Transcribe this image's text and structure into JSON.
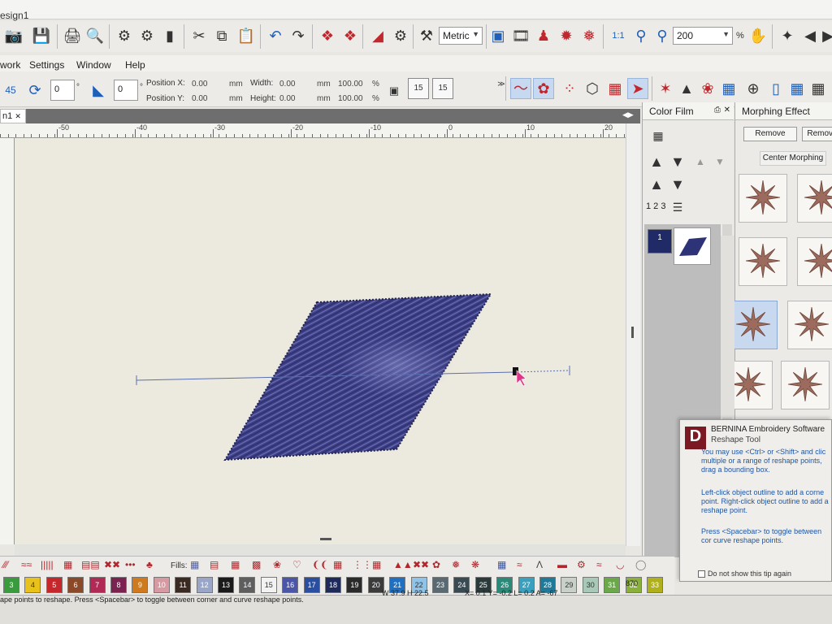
{
  "window": {
    "title": "esign1"
  },
  "toolbar1": {
    "units_value": "Metric",
    "zoom_value": "200",
    "zoom_unit": "%",
    "zoom_1to1_label": "1:1"
  },
  "menu": {
    "items": [
      "work",
      "Settings",
      "Window",
      "Help"
    ]
  },
  "toolbar2": {
    "rotate_label": "45",
    "rotate_value": "0",
    "slant_value": "0",
    "degree_symbol": "°",
    "position_x_label": "Position X:",
    "position_x_value": "0.00",
    "position_y_label": "Position Y:",
    "position_y_value": "0.00",
    "width_label": "Width:",
    "width_value": "0.00",
    "height_label": "Height:",
    "height_value": "0.00",
    "unit_mm": "mm",
    "scale_w": "100.00",
    "scale_h": "100.00",
    "percent": "%",
    "step_label": "15"
  },
  "document": {
    "tab_label": "n1",
    "close_glyph": "✕"
  },
  "ruler": {
    "labels": [
      "-50",
      "-40",
      "-30",
      "-20",
      "-10",
      "0",
      "10",
      "20"
    ]
  },
  "color_film": {
    "title": "Color Film",
    "order_label": "1 2 3",
    "items": [
      {
        "number": "1",
        "color": "#1f2a66"
      }
    ]
  },
  "morphing": {
    "title": "Morphing Effect",
    "remove_label": "Remove",
    "remove_label_2": "Remove",
    "center_label": "Center Morphing"
  },
  "tip": {
    "logo": "D",
    "app": "BERNINA Embroidery Software",
    "tool": "Reshape Tool",
    "p1": "You may use <Ctrl> or <Shift> and clic multiple or a range of reshape points, drag a bounding box.",
    "p2": "Left-click object outline to add a corne point. Right-click object outline to add a reshape point.",
    "p3": "Press <Spacebar> to toggle between cor curve reshape points.",
    "checkbox": "Do not show this tip again"
  },
  "stitch_bar": {
    "fills_label": "Fills:"
  },
  "palette": {
    "swatches": [
      {
        "n": "3",
        "color": "#3a9a3e"
      },
      {
        "n": "4",
        "color": "#e8c21a"
      },
      {
        "n": "5",
        "color": "#c7262b"
      },
      {
        "n": "6",
        "color": "#8a4a2a"
      },
      {
        "n": "7",
        "color": "#b02a55"
      },
      {
        "n": "8",
        "color": "#7a2350"
      },
      {
        "n": "9",
        "color": "#d07a1e"
      },
      {
        "n": "10",
        "color": "#d89aa2"
      },
      {
        "n": "11",
        "color": "#3a2a22"
      },
      {
        "n": "12",
        "color": "#9aa6c8"
      },
      {
        "n": "13",
        "color": "#1a1a1a"
      },
      {
        "n": "14",
        "color": "#5e5e5e"
      },
      {
        "n": "15",
        "color": "#f2f2f2"
      },
      {
        "n": "16",
        "color": "#4b56a8"
      },
      {
        "n": "17",
        "color": "#2a4ea0"
      },
      {
        "n": "18",
        "color": "#1e2a5a"
      },
      {
        "n": "19",
        "color": "#2a2a2a"
      },
      {
        "n": "20",
        "color": "#3b3b3b"
      },
      {
        "n": "21",
        "color": "#1f6fc2"
      },
      {
        "n": "22",
        "color": "#8fc3e8"
      },
      {
        "n": "23",
        "color": "#5a6a72"
      },
      {
        "n": "24",
        "color": "#3a4a52"
      },
      {
        "n": "25",
        "color": "#2a3a3a"
      },
      {
        "n": "26",
        "color": "#2a8a7a"
      },
      {
        "n": "27",
        "color": "#3aa0c0"
      },
      {
        "n": "28",
        "color": "#1f7a9a"
      },
      {
        "n": "29",
        "color": "#c8d0c8"
      },
      {
        "n": "30",
        "color": "#a8c8b8"
      },
      {
        "n": "31",
        "color": "#6aa84a"
      },
      {
        "n": "32",
        "color": "#8ab03a"
      },
      {
        "n": "33",
        "color": "#b0b01a"
      }
    ]
  },
  "status": {
    "hint": "ape points to reshape. Press <Spacebar> to toggle between corner and curve reshape points.",
    "size": "W 37.9 H 22.5",
    "coords": "X=  0.1 Y=  -0.2 L=  0.2 A= -67",
    "count": "870"
  },
  "accents": {
    "stitch_fill": "#3d3f86",
    "stitch_highlight": "#6c6fb6",
    "panel_blue": "#c6d9f1"
  }
}
